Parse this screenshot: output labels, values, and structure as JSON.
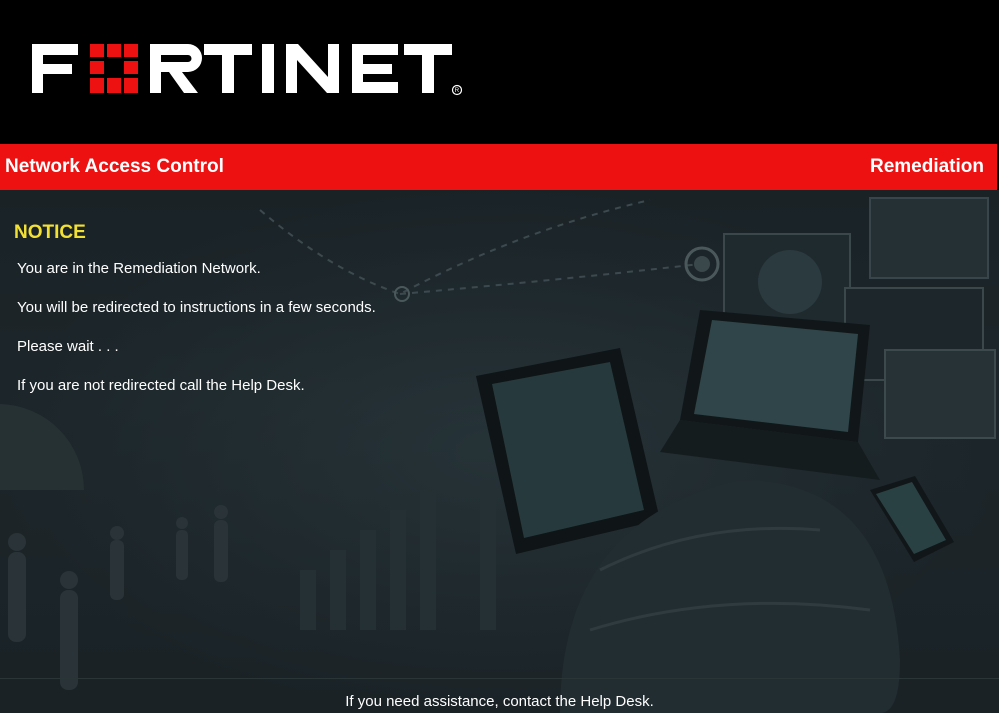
{
  "header": {
    "logo_text": "FORTINET",
    "brand_color": "#ee1111"
  },
  "titlebar": {
    "left": "Network Access Control",
    "right": "Remediation"
  },
  "notice": {
    "title": "NOTICE",
    "lines": [
      "You are in the Remediation Network.",
      "You will be redirected to instructions in a few seconds.",
      "Please wait . . .",
      "If you are not redirected call the Help Desk."
    ]
  },
  "footer": {
    "text": "If you need assistance, contact the Help Desk."
  }
}
